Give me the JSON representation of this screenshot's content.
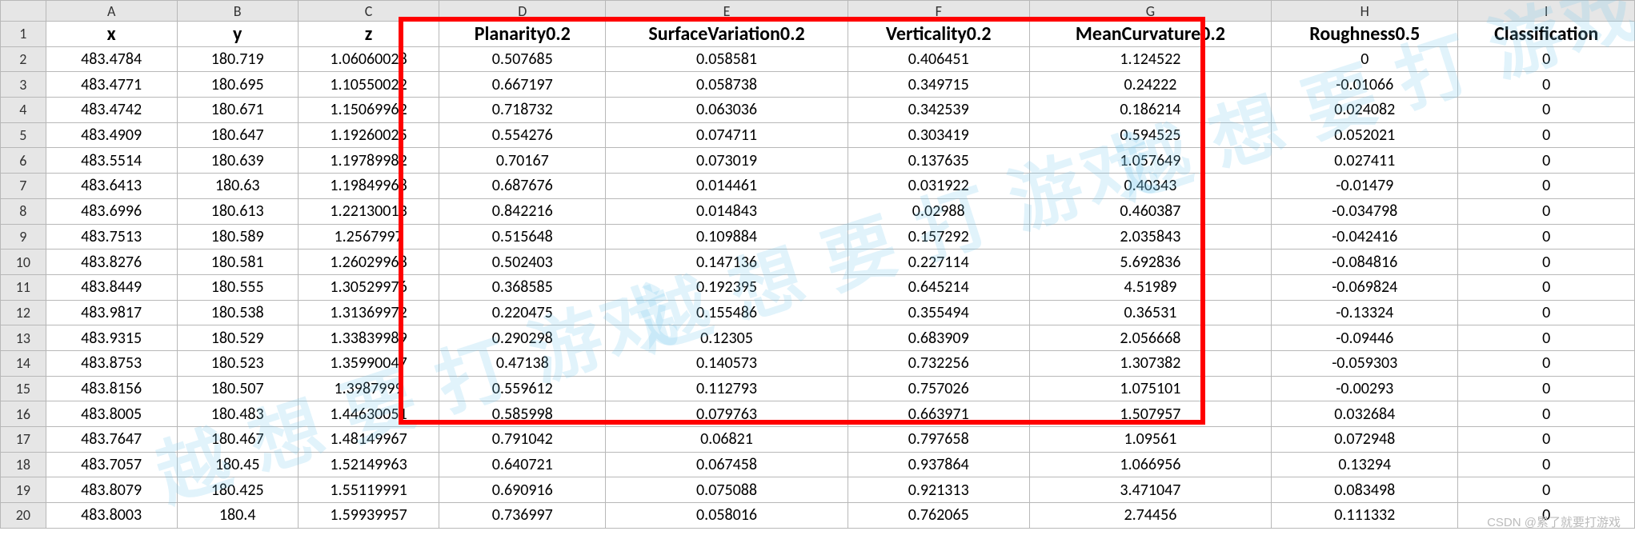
{
  "col_letters": [
    "A",
    "B",
    "C",
    "D",
    "E",
    "F",
    "G",
    "H",
    "I"
  ],
  "headers": [
    "x",
    "y",
    "z",
    "Planarity0.2",
    "SurfaceVariation0.2",
    "Verticality0.2",
    "MeanCurvature0.2",
    "Roughness0.5",
    "Classification"
  ],
  "rows": [
    [
      "483.4784",
      "180.719",
      "1.06060028",
      "0.507685",
      "0.058581",
      "0.406451",
      "1.124522",
      "0",
      "0"
    ],
    [
      "483.4771",
      "180.695",
      "1.10550022",
      "0.667197",
      "0.058738",
      "0.349715",
      "0.24222",
      "-0.01066",
      "0"
    ],
    [
      "483.4742",
      "180.671",
      "1.15069962",
      "0.718732",
      "0.063036",
      "0.342539",
      "0.186214",
      "0.024082",
      "0"
    ],
    [
      "483.4909",
      "180.647",
      "1.19260025",
      "0.554276",
      "0.074711",
      "0.303419",
      "0.594525",
      "0.052021",
      "0"
    ],
    [
      "483.5514",
      "180.639",
      "1.19789982",
      "0.70167",
      "0.073019",
      "0.137635",
      "1.057649",
      "0.027411",
      "0"
    ],
    [
      "483.6413",
      "180.63",
      "1.19849968",
      "0.687676",
      "0.014461",
      "0.031922",
      "0.40343",
      "-0.01479",
      "0"
    ],
    [
      "483.6996",
      "180.613",
      "1.22130013",
      "0.842216",
      "0.014843",
      "0.02988",
      "0.460387",
      "-0.034798",
      "0"
    ],
    [
      "483.7513",
      "180.589",
      "1.2567997",
      "0.515648",
      "0.109884",
      "0.157292",
      "2.035843",
      "-0.042416",
      "0"
    ],
    [
      "483.8276",
      "180.581",
      "1.26029968",
      "0.502403",
      "0.147136",
      "0.227114",
      "5.692836",
      "-0.084816",
      "0"
    ],
    [
      "483.8449",
      "180.555",
      "1.30529976",
      "0.368585",
      "0.192395",
      "0.645214",
      "4.51989",
      "-0.069824",
      "0"
    ],
    [
      "483.9817",
      "180.538",
      "1.31369972",
      "0.220475",
      "0.155486",
      "0.355494",
      "0.36531",
      "-0.13324",
      "0"
    ],
    [
      "483.9315",
      "180.529",
      "1.33839989",
      "0.290298",
      "0.12305",
      "0.683909",
      "2.056668",
      "-0.09446",
      "0"
    ],
    [
      "483.8753",
      "180.523",
      "1.35990047",
      "0.47138",
      "0.140573",
      "0.732256",
      "1.307382",
      "-0.059303",
      "0"
    ],
    [
      "483.8156",
      "180.507",
      "1.3987999",
      "0.559612",
      "0.112793",
      "0.757026",
      "1.075101",
      "-0.00293",
      "0"
    ],
    [
      "483.8005",
      "180.483",
      "1.44630051",
      "0.585998",
      "0.079763",
      "0.663971",
      "1.507957",
      "0.032684",
      "0"
    ],
    [
      "483.7647",
      "180.467",
      "1.48149967",
      "0.791042",
      "0.06821",
      "0.797658",
      "1.09561",
      "0.072948",
      "0"
    ],
    [
      "483.7057",
      "180.45",
      "1.52149963",
      "0.640721",
      "0.067458",
      "0.937864",
      "1.066956",
      "0.13294",
      "0"
    ],
    [
      "483.8079",
      "180.425",
      "1.55119991",
      "0.690916",
      "0.075088",
      "0.921313",
      "3.471047",
      "0.083498",
      "0"
    ],
    [
      "483.8003",
      "180.4",
      "1.59939957",
      "0.736997",
      "0.058016",
      "0.762065",
      "2.74456",
      "0.111332",
      "0"
    ]
  ],
  "watermark_text": "越 想 要 打 游戏",
  "credit_text": "CSDN @累了就要打游戏",
  "chart_data": {
    "type": "table",
    "title": "",
    "columns": [
      "x",
      "y",
      "z",
      "Planarity0.2",
      "SurfaceVariation0.2",
      "Verticality0.2",
      "MeanCurvature0.2",
      "Roughness0.5",
      "Classification"
    ],
    "highlighted_columns": [
      "Planarity0.2",
      "SurfaceVariation0.2",
      "Verticality0.2",
      "MeanCurvature0.2",
      "Roughness0.5"
    ],
    "data": [
      {
        "x": 483.4784,
        "y": 180.719,
        "z": 1.06060028,
        "Planarity0.2": 0.507685,
        "SurfaceVariation0.2": 0.058581,
        "Verticality0.2": 0.406451,
        "MeanCurvature0.2": 1.124522,
        "Roughness0.5": 0,
        "Classification": 0
      },
      {
        "x": 483.4771,
        "y": 180.695,
        "z": 1.10550022,
        "Planarity0.2": 0.667197,
        "SurfaceVariation0.2": 0.058738,
        "Verticality0.2": 0.349715,
        "MeanCurvature0.2": 0.24222,
        "Roughness0.5": -0.01066,
        "Classification": 0
      },
      {
        "x": 483.4742,
        "y": 180.671,
        "z": 1.15069962,
        "Planarity0.2": 0.718732,
        "SurfaceVariation0.2": 0.063036,
        "Verticality0.2": 0.342539,
        "MeanCurvature0.2": 0.186214,
        "Roughness0.5": 0.024082,
        "Classification": 0
      },
      {
        "x": 483.4909,
        "y": 180.647,
        "z": 1.19260025,
        "Planarity0.2": 0.554276,
        "SurfaceVariation0.2": 0.074711,
        "Verticality0.2": 0.303419,
        "MeanCurvature0.2": 0.594525,
        "Roughness0.5": 0.052021,
        "Classification": 0
      },
      {
        "x": 483.5514,
        "y": 180.639,
        "z": 1.19789982,
        "Planarity0.2": 0.70167,
        "SurfaceVariation0.2": 0.073019,
        "Verticality0.2": 0.137635,
        "MeanCurvature0.2": 1.057649,
        "Roughness0.5": 0.027411,
        "Classification": 0
      },
      {
        "x": 483.6413,
        "y": 180.63,
        "z": 1.19849968,
        "Planarity0.2": 0.687676,
        "SurfaceVariation0.2": 0.014461,
        "Verticality0.2": 0.031922,
        "MeanCurvature0.2": 0.40343,
        "Roughness0.5": -0.01479,
        "Classification": 0
      },
      {
        "x": 483.6996,
        "y": 180.613,
        "z": 1.22130013,
        "Planarity0.2": 0.842216,
        "SurfaceVariation0.2": 0.014843,
        "Verticality0.2": 0.02988,
        "MeanCurvature0.2": 0.460387,
        "Roughness0.5": -0.034798,
        "Classification": 0
      },
      {
        "x": 483.7513,
        "y": 180.589,
        "z": 1.2567997,
        "Planarity0.2": 0.515648,
        "SurfaceVariation0.2": 0.109884,
        "Verticality0.2": 0.157292,
        "MeanCurvature0.2": 2.035843,
        "Roughness0.5": -0.042416,
        "Classification": 0
      },
      {
        "x": 483.8276,
        "y": 180.581,
        "z": 1.26029968,
        "Planarity0.2": 0.502403,
        "SurfaceVariation0.2": 0.147136,
        "Verticality0.2": 0.227114,
        "MeanCurvature0.2": 5.692836,
        "Roughness0.5": -0.084816,
        "Classification": 0
      },
      {
        "x": 483.8449,
        "y": 180.555,
        "z": 1.30529976,
        "Planarity0.2": 0.368585,
        "SurfaceVariation0.2": 0.192395,
        "Verticality0.2": 0.645214,
        "MeanCurvature0.2": 4.51989,
        "Roughness0.5": -0.069824,
        "Classification": 0
      },
      {
        "x": 483.9817,
        "y": 180.538,
        "z": 1.31369972,
        "Planarity0.2": 0.220475,
        "SurfaceVariation0.2": 0.155486,
        "Verticality0.2": 0.355494,
        "MeanCurvature0.2": 0.36531,
        "Roughness0.5": -0.13324,
        "Classification": 0
      },
      {
        "x": 483.9315,
        "y": 180.529,
        "z": 1.33839989,
        "Planarity0.2": 0.290298,
        "SurfaceVariation0.2": 0.12305,
        "Verticality0.2": 0.683909,
        "MeanCurvature0.2": 2.056668,
        "Roughness0.5": -0.09446,
        "Classification": 0
      },
      {
        "x": 483.8753,
        "y": 180.523,
        "z": 1.35990047,
        "Planarity0.2": 0.47138,
        "SurfaceVariation0.2": 0.140573,
        "Verticality0.2": 0.732256,
        "MeanCurvature0.2": 1.307382,
        "Roughness0.5": -0.059303,
        "Classification": 0
      },
      {
        "x": 483.8156,
        "y": 180.507,
        "z": 1.3987999,
        "Planarity0.2": 0.559612,
        "SurfaceVariation0.2": 0.112793,
        "Verticality0.2": 0.757026,
        "MeanCurvature0.2": 1.075101,
        "Roughness0.5": -0.00293,
        "Classification": 0
      },
      {
        "x": 483.8005,
        "y": 180.483,
        "z": 1.44630051,
        "Planarity0.2": 0.585998,
        "SurfaceVariation0.2": 0.079763,
        "Verticality0.2": 0.663971,
        "MeanCurvature0.2": 1.507957,
        "Roughness0.5": 0.032684,
        "Classification": 0
      },
      {
        "x": 483.7647,
        "y": 180.467,
        "z": 1.48149967,
        "Planarity0.2": 0.791042,
        "SurfaceVariation0.2": 0.06821,
        "Verticality0.2": 0.797658,
        "MeanCurvature0.2": 1.09561,
        "Roughness0.5": 0.072948,
        "Classification": 0
      },
      {
        "x": 483.7057,
        "y": 180.45,
        "z": 1.52149963,
        "Planarity0.2": 0.640721,
        "SurfaceVariation0.2": 0.067458,
        "Verticality0.2": 0.937864,
        "MeanCurvature0.2": 1.066956,
        "Roughness0.5": 0.13294,
        "Classification": 0
      },
      {
        "x": 483.8079,
        "y": 180.425,
        "z": 1.55119991,
        "Planarity0.2": 0.690916,
        "SurfaceVariation0.2": 0.075088,
        "Verticality0.2": 0.921313,
        "MeanCurvature0.2": 3.471047,
        "Roughness0.5": 0.083498,
        "Classification": 0
      },
      {
        "x": 483.8003,
        "y": 180.4,
        "z": 1.59939957,
        "Planarity0.2": 0.736997,
        "SurfaceVariation0.2": 0.058016,
        "Verticality0.2": 0.762065,
        "MeanCurvature0.2": 2.74456,
        "Roughness0.5": 0.111332,
        "Classification": 0
      }
    ]
  }
}
